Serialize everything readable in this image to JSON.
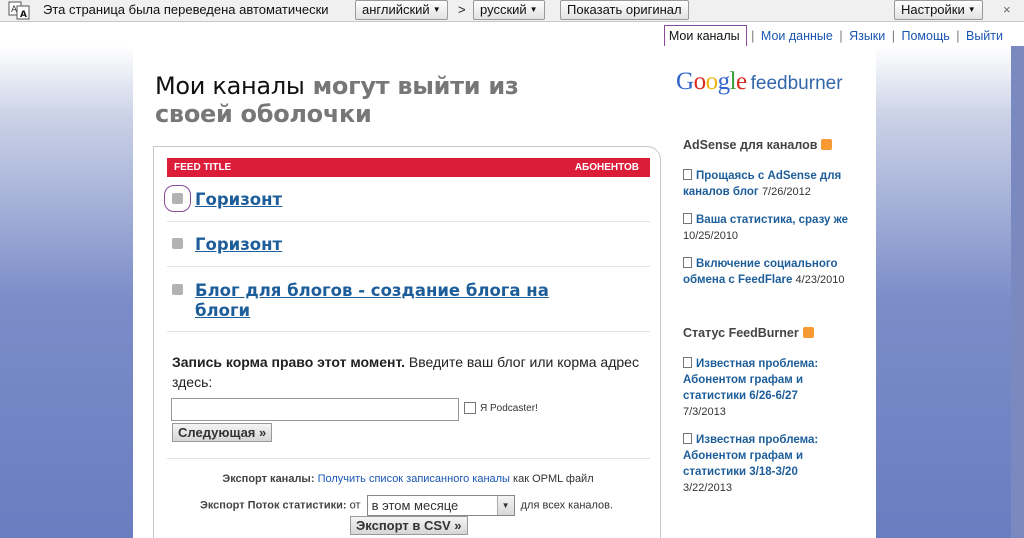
{
  "translate_bar": {
    "message": "Эта страница была переведена автоматически",
    "from_lang": "английский",
    "arrow": ">",
    "to_lang": "русский",
    "show_original": "Показать оригинал",
    "settings": "Настройки",
    "close": "×"
  },
  "topnav": {
    "my_feeds": "Мои каналы",
    "my_account": "Мои данные",
    "languages": "Языки",
    "help": "Помощь",
    "signout": "Выйти",
    "sep": "|"
  },
  "page_title": {
    "main": "Мои каналы",
    "rest": "могут выйти из своей оболочки"
  },
  "logo": {
    "google": "Google",
    "feedburner": "feedburner"
  },
  "feeds_table": {
    "col_title": "FEED TITLE",
    "col_subscribers": "АБОНЕНТОВ",
    "rows": [
      {
        "title": "Горизонт"
      },
      {
        "title": "Горизонт"
      },
      {
        "title": "Блог для блогов - создание блога на блоги"
      }
    ]
  },
  "burn_form": {
    "lead": "Запись корма право этот момент.",
    "text": "Введите ваш блог или корма адрес здесь:",
    "input_value": "",
    "podcaster_label": "Я Podcaster!",
    "next_button": "Следующая »"
  },
  "export": {
    "feeds_label": "Экспорт каналы:",
    "feeds_link": "Получить список записанного каналы",
    "feeds_suffix": "как OPML файл",
    "stats_label": "Экспорт Поток статистики:",
    "from": "от",
    "period_selected": "в этом месяце",
    "stats_suffix": "для всех каналов.",
    "csv_button": "Экспорт в CSV »"
  },
  "sidebar": {
    "adsense_heading": "AdSense для каналов",
    "adsense_items": [
      {
        "title": "Прощаясь с AdSense для каналов блог",
        "date": "7/26/2012"
      },
      {
        "title": "Ваша статистика, сразу же",
        "date": "10/25/2010"
      },
      {
        "title": "Включение социального обмена с FeedFlare",
        "date": "4/23/2010"
      }
    ],
    "status_heading": "Статус FeedBurner",
    "status_items": [
      {
        "title": "Известная проблема: Абонентом графам и статистики 6/26-6/27",
        "date": "7/3/2013"
      },
      {
        "title": "Известная проблема: Абонентом графам и статистики 3/18-3/20",
        "date": "3/22/2013"
      }
    ]
  },
  "colors": {
    "table_header": "#dc1d3a",
    "link": "#1d5e9a",
    "rss": "#f79a33",
    "selection_outline": "#8b4a9a"
  }
}
